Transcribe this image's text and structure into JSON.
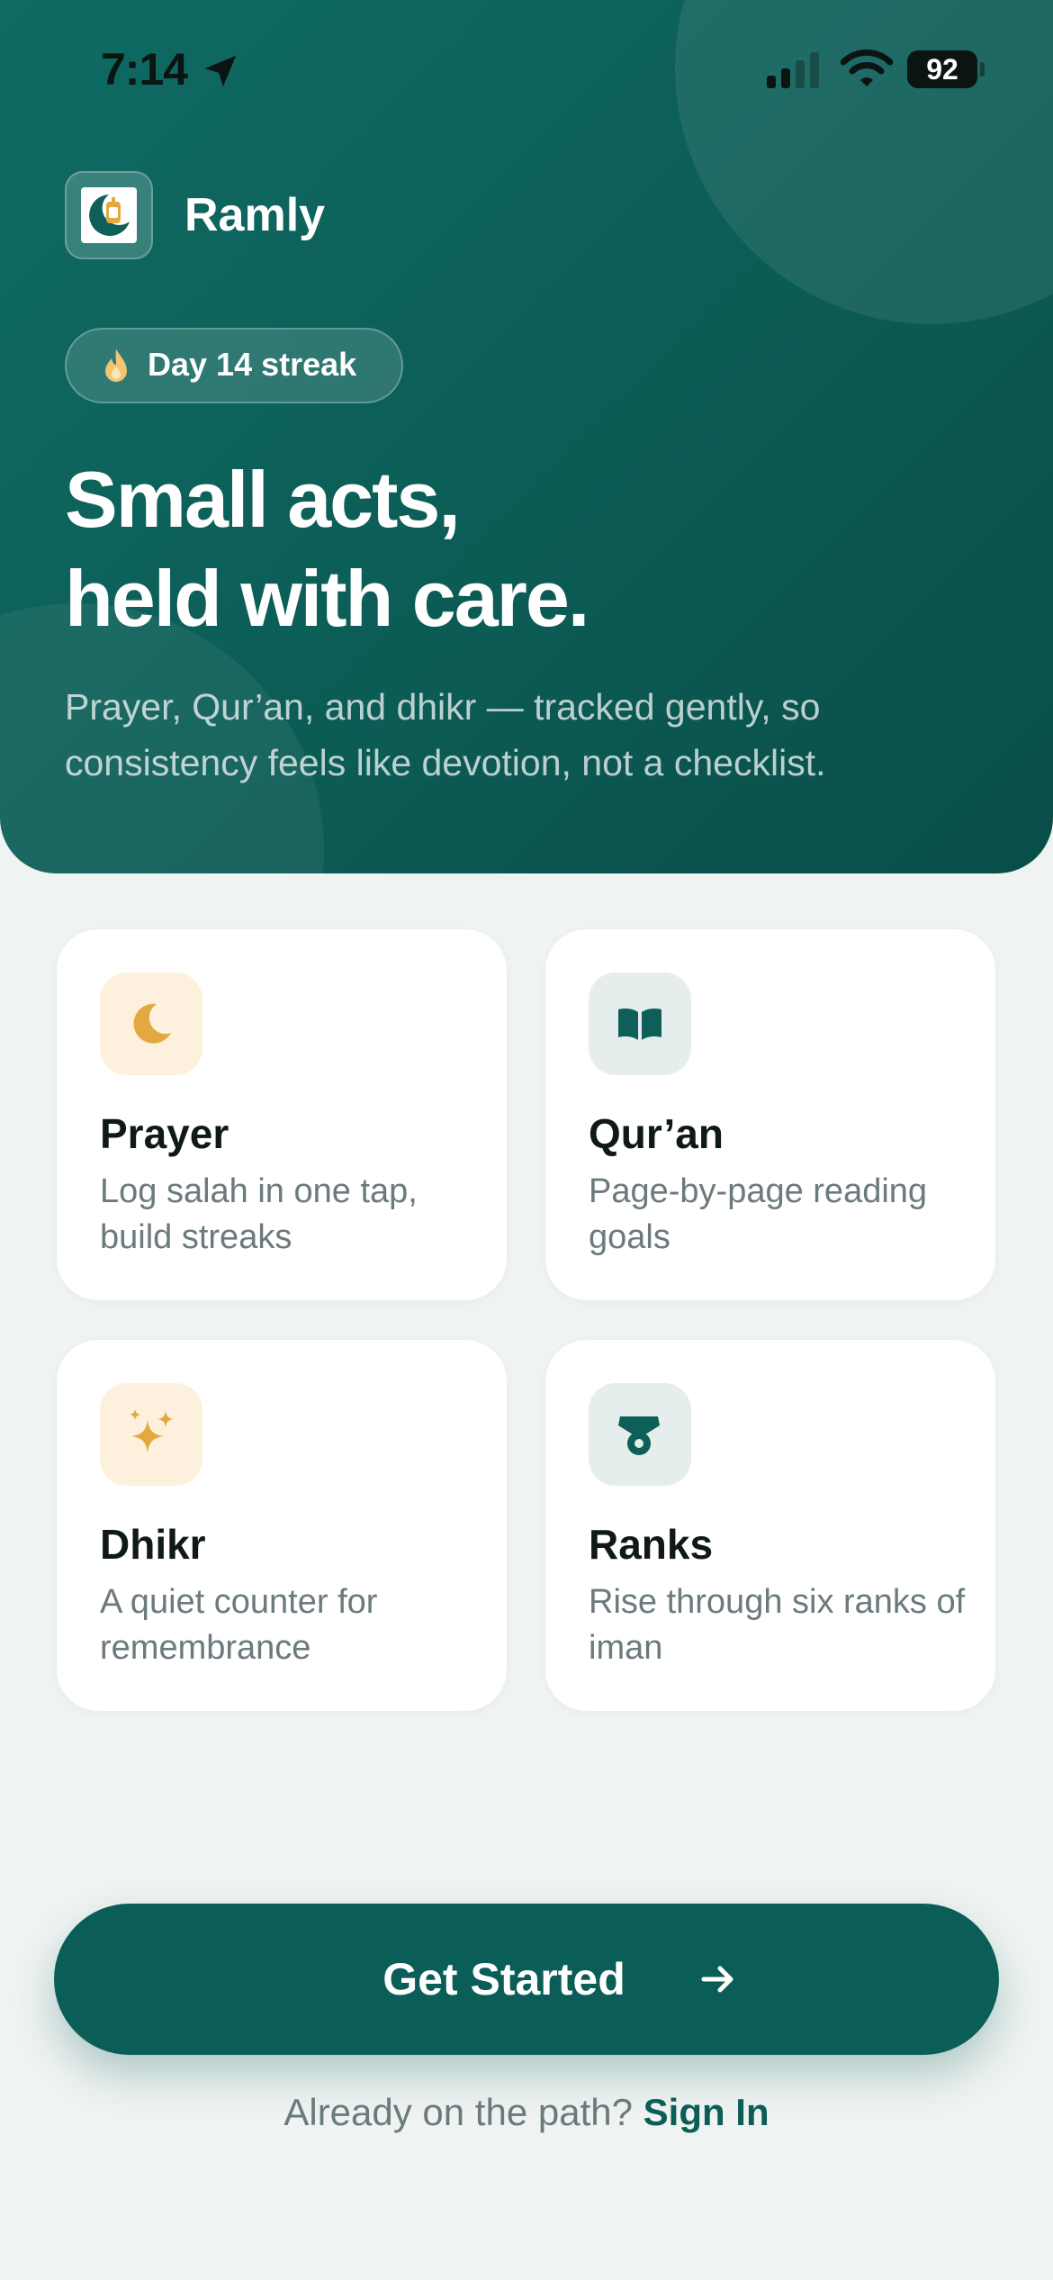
{
  "status_bar": {
    "time": "7:14",
    "battery": "92"
  },
  "app": {
    "name": "Ramly"
  },
  "streak": {
    "label": "Day 14 streak"
  },
  "hero": {
    "headline_line1": "Small acts,",
    "headline_line2": "held with care.",
    "subtext": "Prayer, Qur’an, and dhikr — tracked gently, so consistency feels like devotion, not a checklist."
  },
  "features": [
    {
      "title": "Prayer",
      "description": "Log salah in one tap, build streaks",
      "icon": "moon-icon"
    },
    {
      "title": "Qur’an",
      "description": "Page-by-page reading goals",
      "icon": "book-icon"
    },
    {
      "title": "Dhikr",
      "description": "A quiet counter for remembrance",
      "icon": "sparkles-icon"
    },
    {
      "title": "Ranks",
      "description": "Rise through six ranks of iman",
      "icon": "medal-icon"
    }
  ],
  "cta": {
    "label": "Get Started"
  },
  "signin": {
    "prompt": "Already on the path?",
    "link": "Sign In"
  },
  "colors": {
    "primary": "#0b5e57",
    "hero_gradient_start": "#0f6b64",
    "hero_gradient_end": "#0a4d48",
    "gold_accent": "#e3a840",
    "gold_bg": "#fdf1dd",
    "teal_bg": "#e6eeed",
    "background": "#eff3f2"
  }
}
